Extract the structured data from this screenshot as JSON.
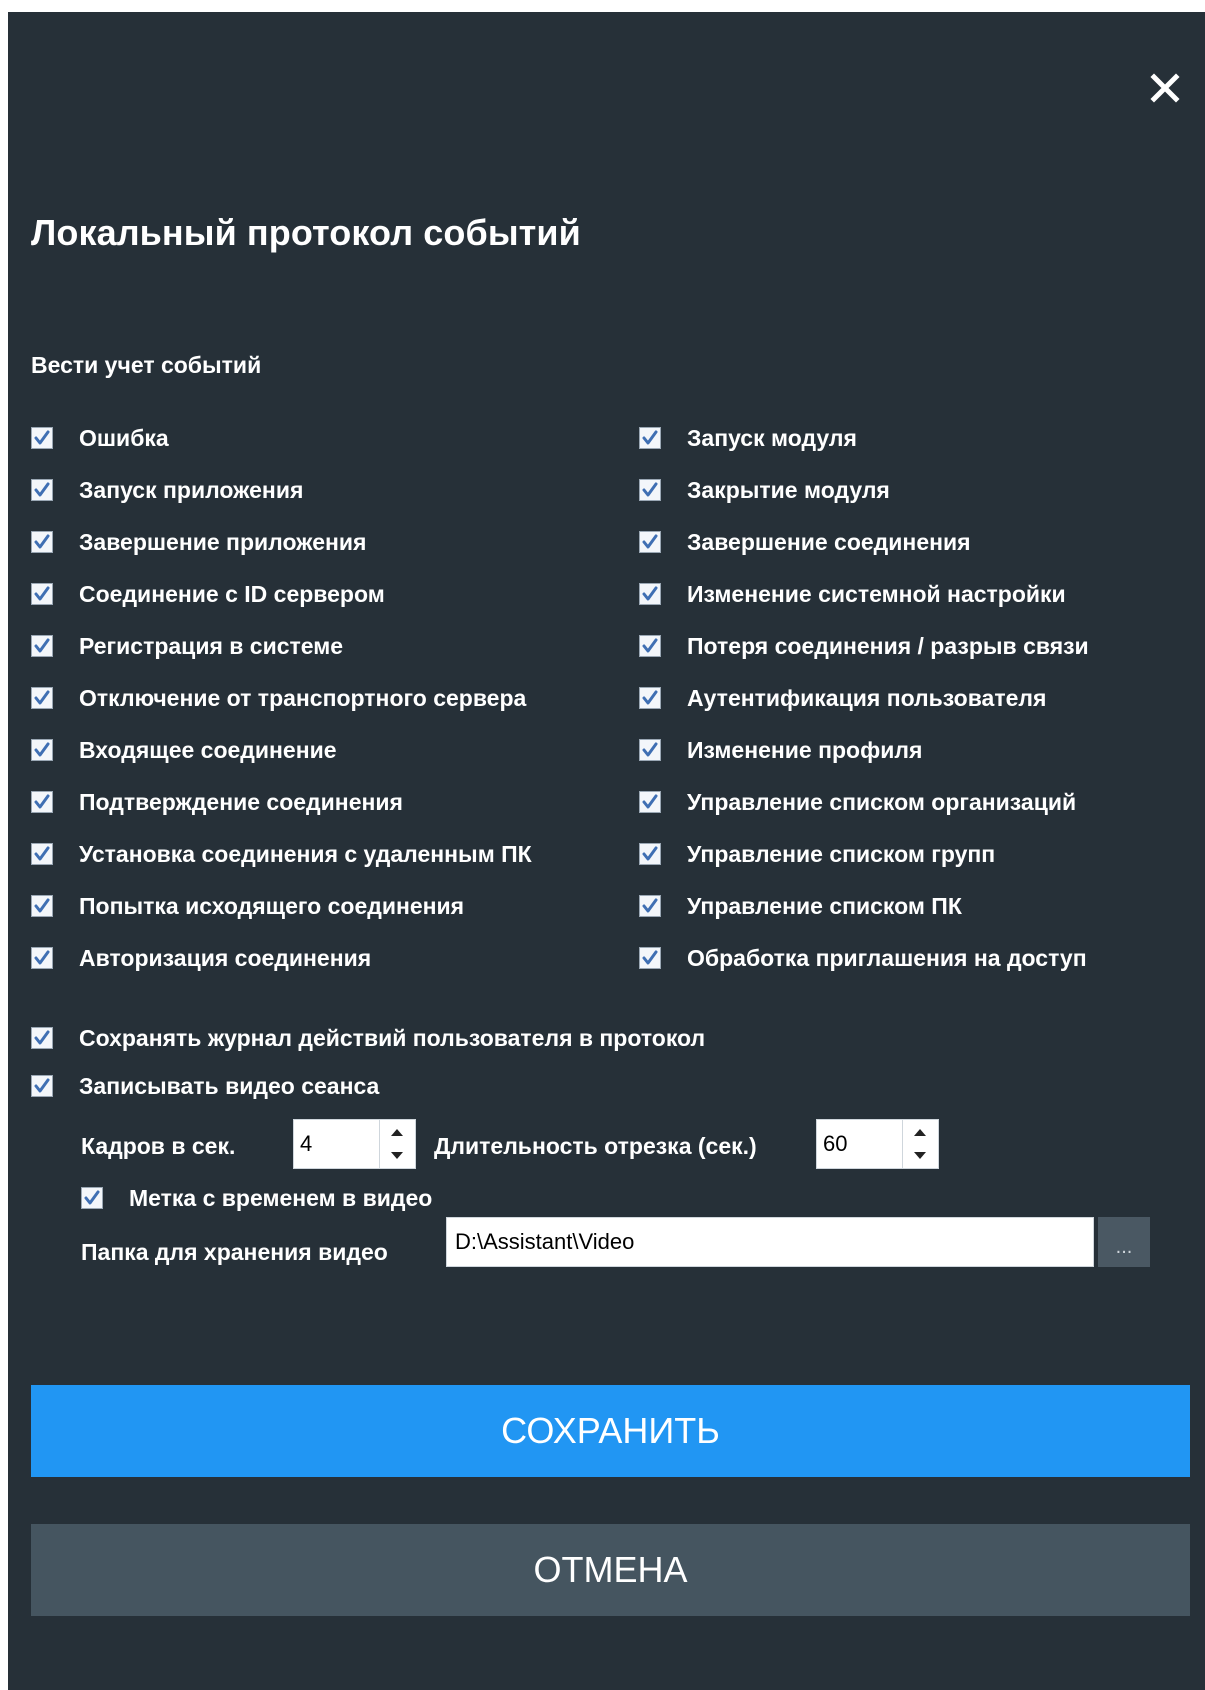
{
  "dialog": {
    "title": "Локальный протокол событий",
    "close_icon": "close-icon",
    "section_label": "Вести учет событий"
  },
  "events_left": [
    {
      "label": "Ошибка",
      "checked": true
    },
    {
      "label": "Запуск приложения",
      "checked": true
    },
    {
      "label": "Завершение приложения",
      "checked": true
    },
    {
      "label": "Соединение с ID сервером",
      "checked": true
    },
    {
      "label": "Регистрация в системе",
      "checked": true
    },
    {
      "label": "Отключение от транспортного сервера",
      "checked": true
    },
    {
      "label": "Входящее соединение",
      "checked": true
    },
    {
      "label": "Подтверждение соединения",
      "checked": true
    },
    {
      "label": "Установка соединения с удаленным ПК",
      "checked": true
    },
    {
      "label": "Попытка исходящего соединения",
      "checked": true
    },
    {
      "label": "Авторизация соединения",
      "checked": true
    }
  ],
  "events_right": [
    {
      "label": "Запуск модуля",
      "checked": true
    },
    {
      "label": "Закрытие модуля",
      "checked": true
    },
    {
      "label": "Завершение соединения",
      "checked": true
    },
    {
      "label": "Изменение системной настройки",
      "checked": true
    },
    {
      "label": "Потеря соединения / разрыв связи",
      "checked": true
    },
    {
      "label": "Аутентификация пользователя",
      "checked": true
    },
    {
      "label": "Изменение профиля",
      "checked": true
    },
    {
      "label": "Управление списком организаций",
      "checked": true
    },
    {
      "label": "Управление списком групп",
      "checked": true
    },
    {
      "label": "Управление списком ПК",
      "checked": true
    },
    {
      "label": "Обработка приглашения на доступ",
      "checked": true
    }
  ],
  "options": {
    "save_user_log": {
      "label": "Сохранять журнал действий пользователя в протокол",
      "checked": true
    },
    "record_video": {
      "label": "Записывать видео сеанса",
      "checked": true
    },
    "fps_label": "Кадров в сек.",
    "fps_value": "4",
    "segment_label": "Длительность отрезка (сек.)",
    "segment_value": "60",
    "timestamp": {
      "label": "Метка с временем в видео",
      "checked": true
    },
    "folder_label": "Папка для хранения видео",
    "folder_value": "D:\\Assistant\\Video",
    "browse_label": "..."
  },
  "buttons": {
    "save": "СОХРАНИТЬ",
    "cancel": "ОТМЕНА"
  },
  "colors": {
    "background": "#263038",
    "primary": "#2196f3",
    "secondary": "#455560",
    "check": "#3f6fb3"
  }
}
